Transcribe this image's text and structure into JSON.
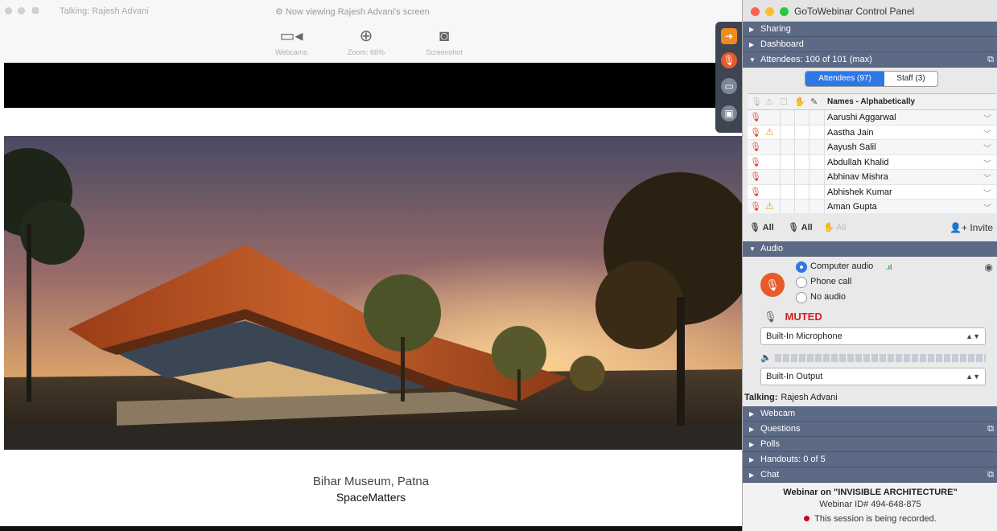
{
  "viewer": {
    "talking": "Talking: Rajesh Advani",
    "viewing": "⚙ Now viewing Rajesh Advani's screen",
    "tools": [
      {
        "icon": "webcam-icon",
        "glyph": "▭◂",
        "label": "Webcams"
      },
      {
        "icon": "zoom-icon",
        "glyph": "⊕",
        "label": "Zoom: 66%"
      },
      {
        "icon": "camera-icon",
        "glyph": "◙",
        "label": "Screenshot"
      }
    ],
    "caption": {
      "title": "Bihar Museum, Patna",
      "subtitle": "SpaceMatters"
    }
  },
  "panel": {
    "title": "GoToWebinar Control Panel",
    "sections": {
      "sharing": "Sharing",
      "dashboard": "Dashboard",
      "attendees": "Attendees: 100 of 101 (max)",
      "audio": "Audio",
      "webcam": "Webcam",
      "questions": "Questions",
      "polls": "Polls",
      "handouts": "Handouts: 0 of 5",
      "chat": "Chat"
    },
    "tabs": {
      "attendees": "Attendees (97)",
      "staff": "Staff (3)"
    },
    "table_header": "Names - Alphabetically",
    "attendees": [
      {
        "name": "Aarushi Aggarwal",
        "warn": false
      },
      {
        "name": "Aastha Jain",
        "warn": true
      },
      {
        "name": "Aayush Salil",
        "warn": false
      },
      {
        "name": "Abdullah Khalid",
        "warn": false
      },
      {
        "name": "Abhinav Mishra",
        "warn": false
      },
      {
        "name": "Abhishek Kumar",
        "warn": false
      },
      {
        "name": "Aman Gupta",
        "warn": true
      }
    ],
    "mute_bar": {
      "mute_all": "All",
      "unmute_all": "All",
      "other_all": "All",
      "invite": "Invite"
    },
    "audio": {
      "options": [
        "Computer audio",
        "Phone call",
        "No audio"
      ],
      "selected": "Computer audio",
      "signal": ".ıl",
      "status": "MUTED",
      "microphone": "Built-In Microphone",
      "speaker": "Built-In Output",
      "talking_label": "Talking:",
      "talking_name": "Rajesh Advani"
    },
    "footer": {
      "webinar_title": "Webinar on \"INVISIBLE ARCHITECTURE\"",
      "webinar_id": "Webinar ID# 494-648-875",
      "recording": "This session is being recorded."
    },
    "colors": {
      "section": "#5c6a86",
      "accent": "#2d78e6",
      "muted": "#d62020",
      "orange": "#e85a2b"
    }
  }
}
